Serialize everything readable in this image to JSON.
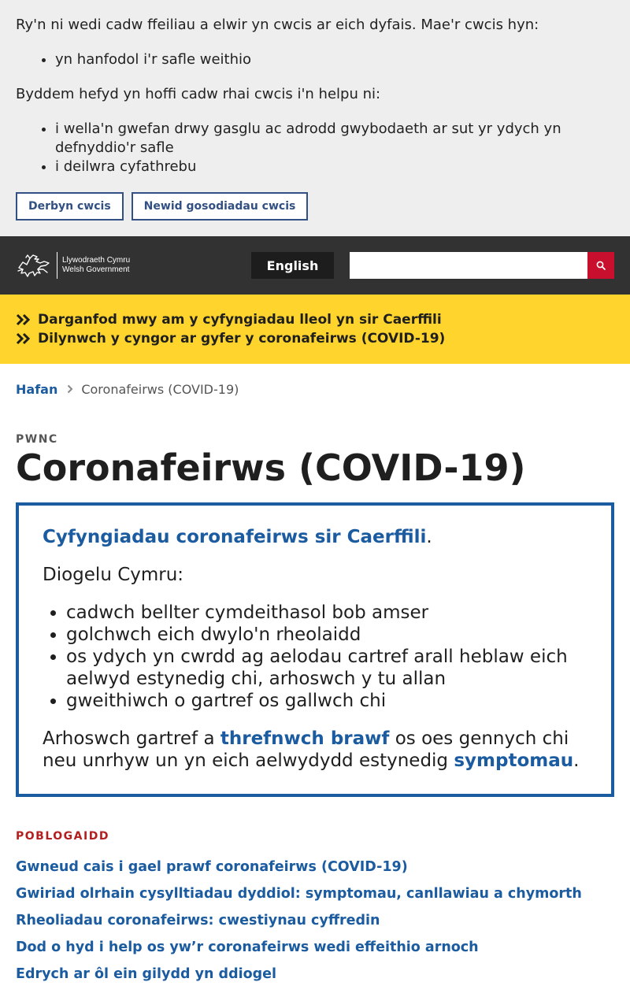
{
  "cookie_banner": {
    "intro": "Ry'n ni wedi cadw ffeiliau a elwir yn cwcis ar eich dyfais. Mae'r cwcis hyn:",
    "essential_items": [
      "yn hanfodol i'r safle weithio"
    ],
    "also": "Byddem hefyd yn hoffi cadw rhai cwcis i'n helpu ni:",
    "optional_items": [
      "i wella'n gwefan drwy gasglu ac adrodd gwybodaeth ar sut yr ydych yn defnyddio'r safle",
      "i deilwra cyfathrebu"
    ],
    "accept_label": "Derbyn cwcis",
    "settings_label": "Newid gosodiadau cwcis"
  },
  "header": {
    "logo_line1": "Llywodraeth Cymru",
    "logo_line2": "Welsh Government",
    "language_label": "English",
    "search_placeholder": ""
  },
  "alert": {
    "links": [
      "Darganfod mwy am y cyfyngiadau lleol yn sir Caerffili",
      "Dilynwch y cyngor ar gyfer y coronafeirws (COVID-19)"
    ]
  },
  "breadcrumb": {
    "home": "Hafan",
    "current": "Coronafeirws (COVID-19)"
  },
  "page": {
    "kicker": "PWNC",
    "title": "Coronafeirws (COVID-19)"
  },
  "callout": {
    "lead_link": "Cyfyngiadau coronafeirws sir Caerffili",
    "lead_suffix": ".",
    "heading": "Diogelu Cymru:",
    "items": [
      "cadwch bellter cymdeithasol bob amser",
      "golchwch eich dwylo'n rheolaidd",
      "os ydych yn cwrdd ag aelodau cartref arall heblaw eich aelwyd estynedig chi, arhoswch y tu allan",
      "gweithiwch o gartref os gallwch chi"
    ],
    "stay_home_prefix": "Arhoswch gartref a ",
    "test_link": "threfnwch brawf",
    "stay_home_middle": " os oes gennych chi neu unrhyw un yn eich aelwydydd estynedig ",
    "symptoms_link": "symptomau",
    "stay_home_suffix": "."
  },
  "popular": {
    "title": "POBLOGAIDD",
    "links": [
      "Gwneud cais i gael prawf coronafeirws (COVID-19)",
      "Gwiriad olrhain cysylltiadau dyddiol: symptomau, canllawiau a chymorth",
      "Rheoliadau coronafeirws: cwestiynau cyffredin",
      "Dod o hyd i help os yw’r coronafeirws wedi effeithio arnoch",
      "Edrych ar ôl ein gilydd yn ddiogel"
    ]
  },
  "colors": {
    "header_bg": "#323232",
    "alert_bg": "#ffd42c",
    "link_blue": "#1b5ba0",
    "search_red": "#c8102e",
    "popular_red": "#b31f1f"
  },
  "icons": [
    "welsh-dragon-logo-icon",
    "search-icon",
    "double-chevron-right-icon",
    "chevron-right-icon"
  ]
}
